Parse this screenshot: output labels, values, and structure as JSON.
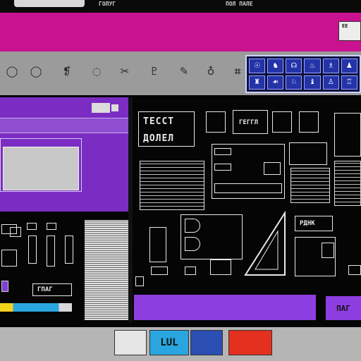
{
  "window": {
    "title_fragments": [
      "ГОЛУГ",
      "ПОЛ ПАЛЕ"
    ],
    "corner_label": "ЕЕ"
  },
  "toolbar": {
    "tools": [
      {
        "name": "circle-tool-icon",
        "glyph": "◯"
      },
      {
        "name": "circle-tool-icon-2",
        "glyph": "◯"
      },
      {
        "name": "node-tool-icon",
        "glyph": "❡"
      },
      {
        "name": "ring-tool-icon",
        "glyph": "◌"
      },
      {
        "name": "scissors-icon",
        "glyph": "✂"
      },
      {
        "name": "pin-tool-icon",
        "glyph": "♇"
      },
      {
        "name": "pen-tool-icon",
        "glyph": "✎"
      },
      {
        "name": "hook-tool-icon",
        "glyph": "♁"
      },
      {
        "name": "crop-tool-icon",
        "glyph": "⌗"
      }
    ]
  },
  "icon_panel": {
    "cells": [
      "☉",
      "♞",
      "☊",
      "♨",
      "♗",
      "♟",
      "♜",
      "☙",
      "♘",
      "♝",
      "♙",
      "♖"
    ]
  },
  "panels": {
    "big_title": [
      "ТЕССТ",
      "ДОЛЕЛ"
    ],
    "small_labels": [
      "ГПАГ",
      "ГЕГГЛ",
      "РДНК"
    ],
    "purple_button": "ПАГ"
  },
  "taskbar": {
    "thumb_label": "LUL"
  },
  "colors": {
    "magenta": "#c8128f",
    "violet": "#7b2cc3",
    "panel_blue": "#2433a8",
    "accent_purple": "#8d3ee0"
  }
}
